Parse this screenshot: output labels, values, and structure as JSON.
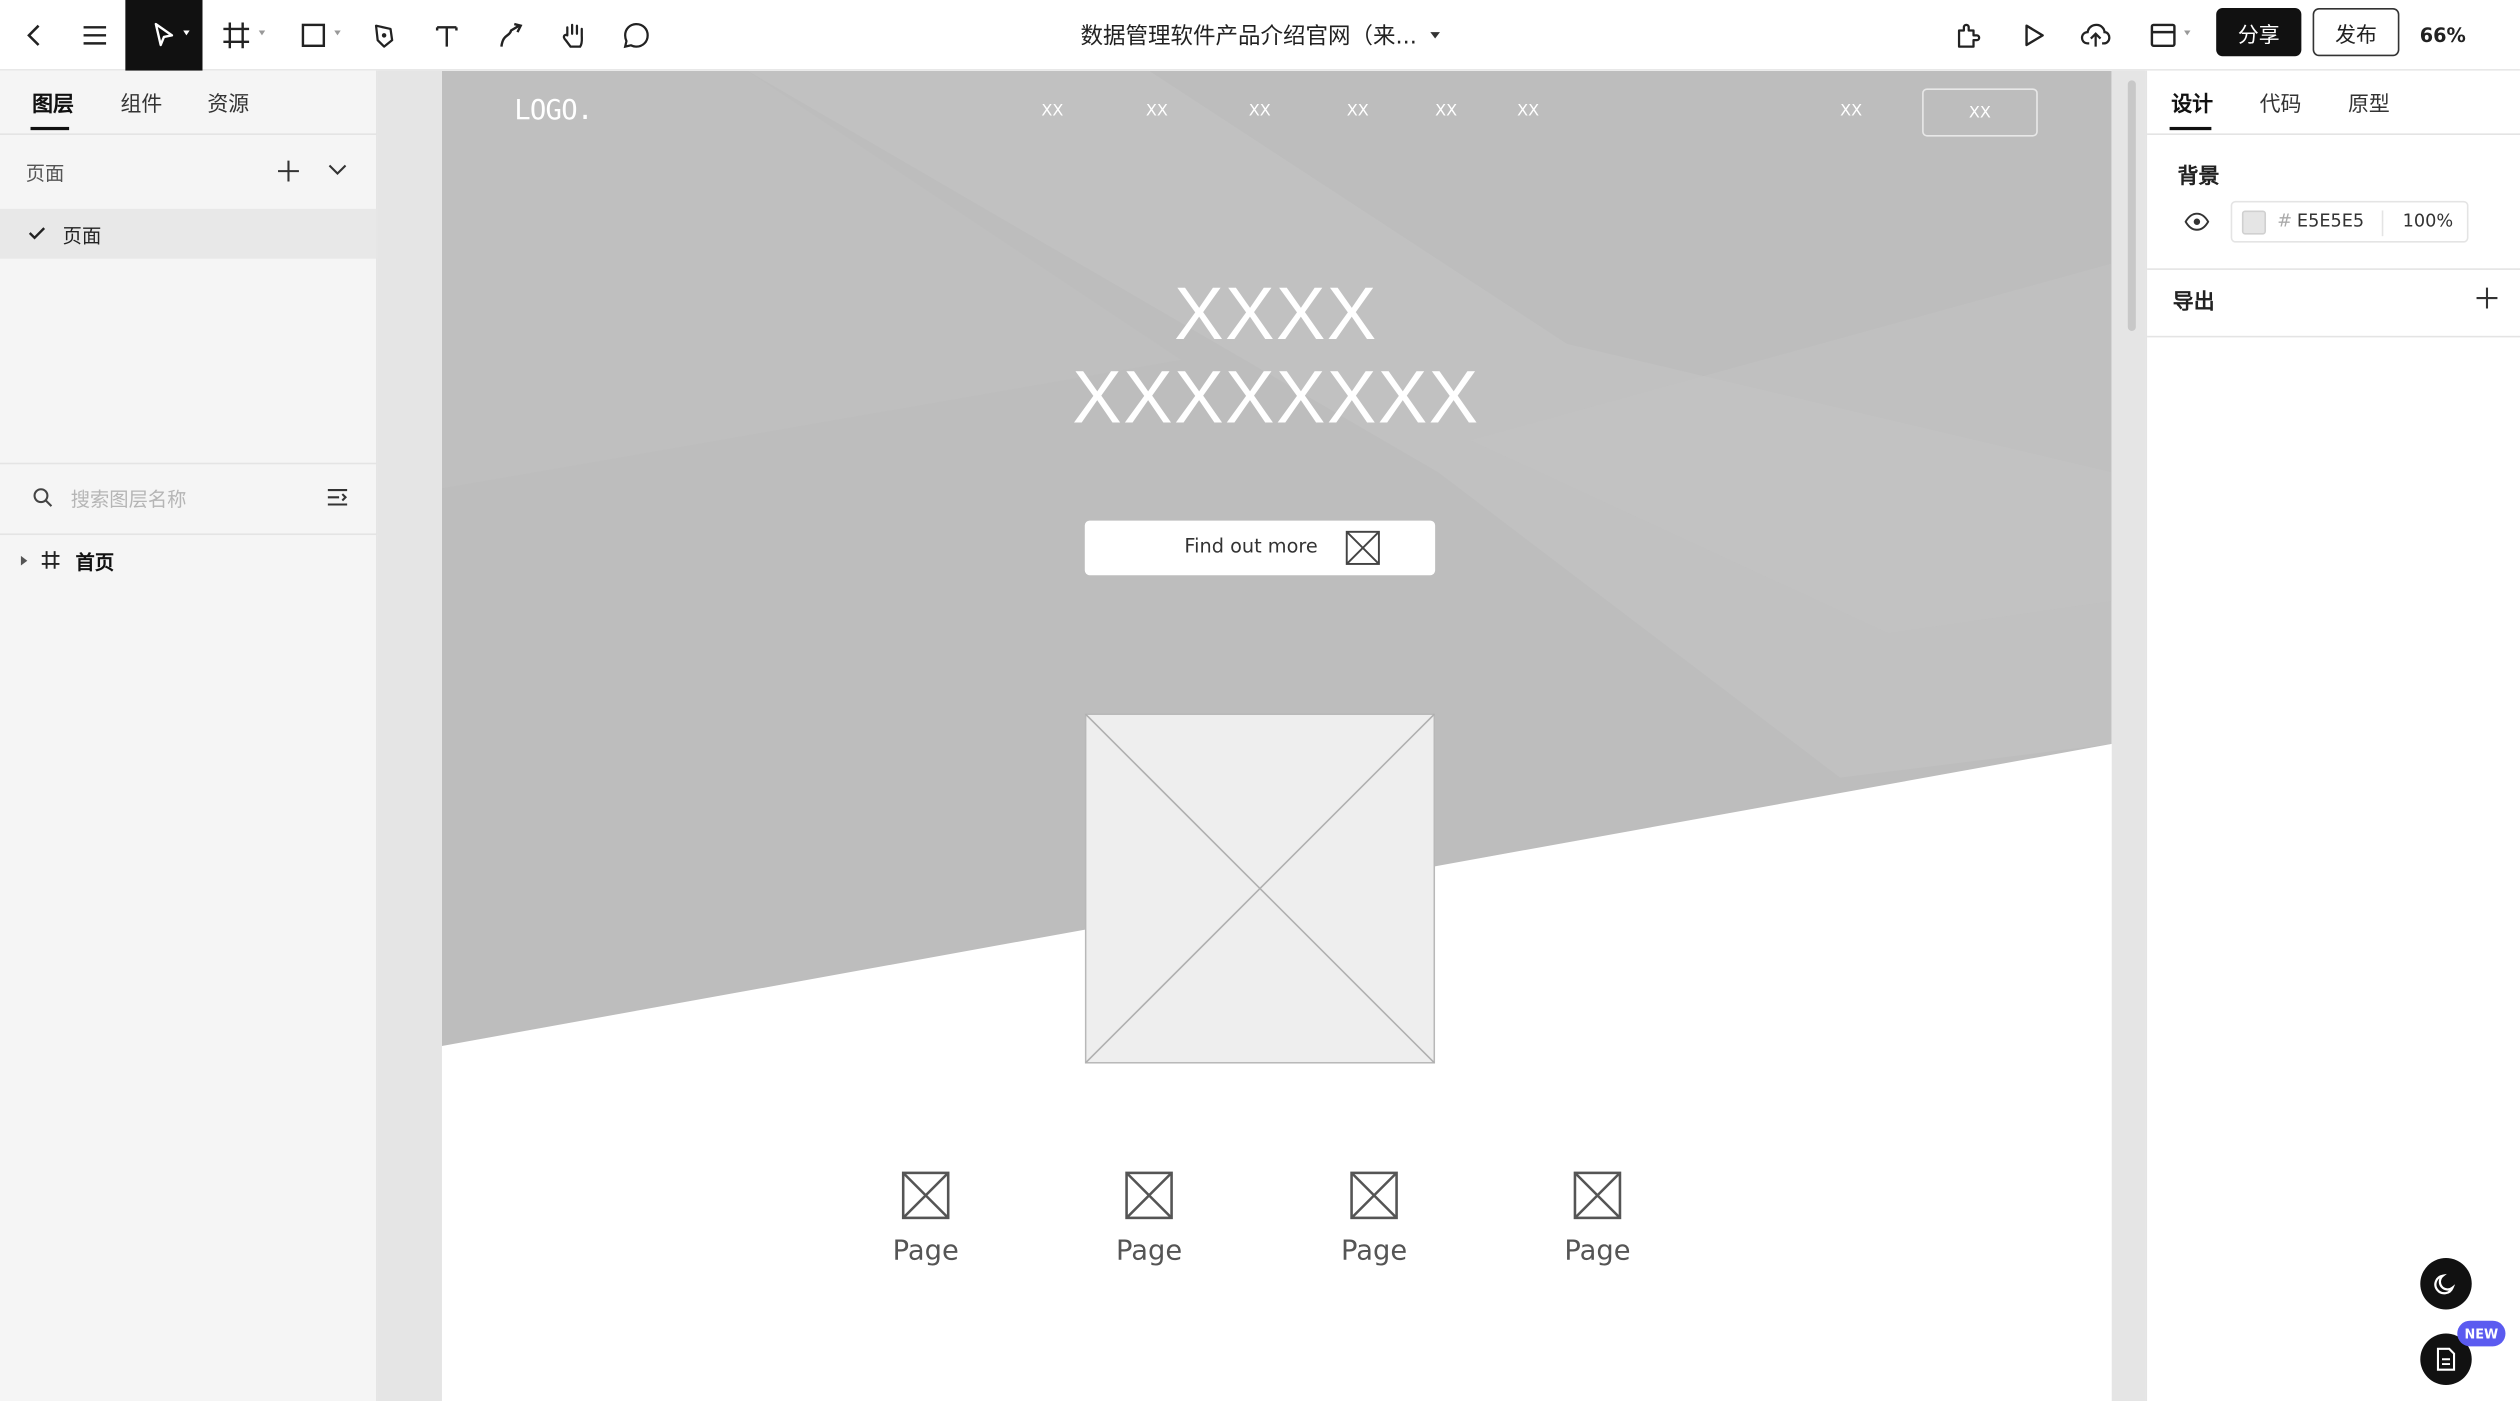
{
  "toolbar": {
    "document_title": "数据管理软件产品介绍官网（来...",
    "share_label": "分享",
    "publish_label": "发布",
    "zoom_level": "66%",
    "icons": [
      "back-icon",
      "menu-icon",
      "pointer-icon",
      "frame-icon",
      "rectangle-icon",
      "pen-icon",
      "text-icon",
      "connector-icon",
      "hand-icon",
      "comment-icon",
      "plugin-icon",
      "play-icon",
      "cloud-upload-icon",
      "layout-icon"
    ]
  },
  "left_panel": {
    "tabs": [
      "图层",
      "组件",
      "资源"
    ],
    "pages_header": "页面",
    "pages": [
      "页面"
    ],
    "search_placeholder": "搜索图层名称",
    "layers": [
      "首页"
    ]
  },
  "canvas": {
    "logo": "LOGO.",
    "nav_items": [
      "XX",
      "XX",
      "XX",
      "XX",
      "XX",
      "XX"
    ],
    "nav_extra": "XX",
    "nav_button": "XX",
    "hero_line1": "XXXX",
    "hero_line2": "XXXXXXXX",
    "cta_label": "Find out more",
    "page_cards": [
      "Page",
      "Page",
      "Page",
      "Page"
    ],
    "colors": {
      "hero": "#bdbdbd",
      "placeholder": "#eeeeee"
    }
  },
  "right_panel": {
    "tabs": [
      "设计",
      "代码",
      "原型"
    ],
    "background_label": "背景",
    "background_hex": "E5E5E5",
    "background_opacity": "100%",
    "export_label": "导出",
    "new_badge": "NEW"
  }
}
